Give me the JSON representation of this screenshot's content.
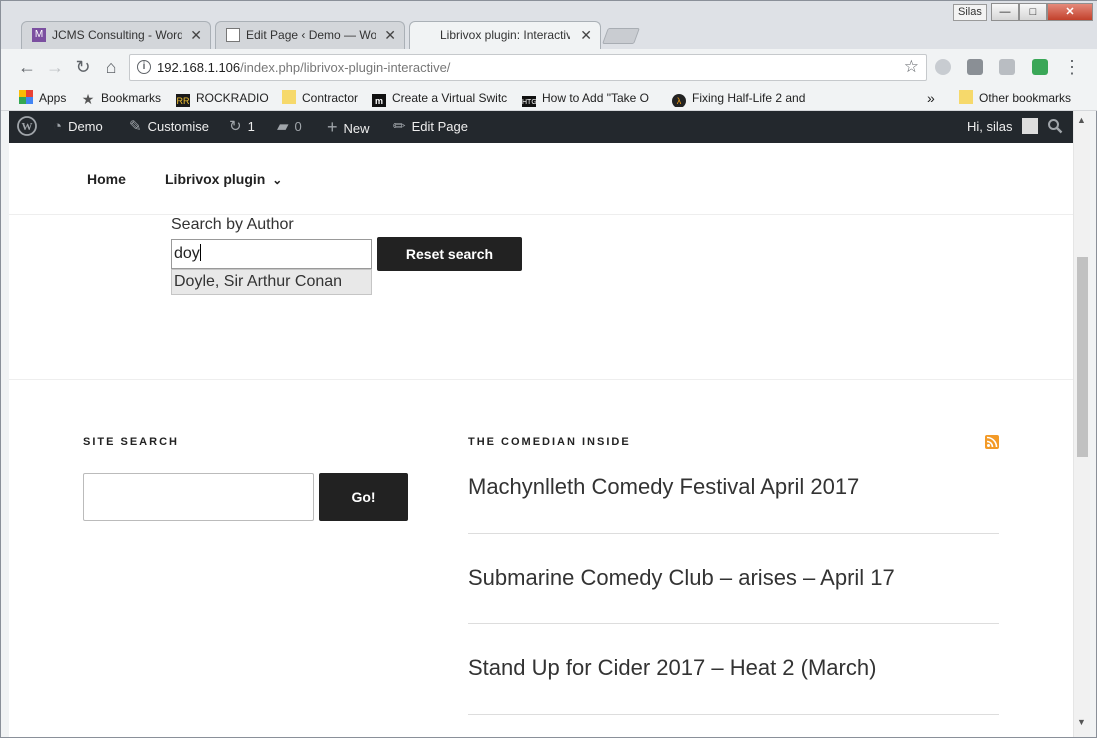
{
  "window": {
    "user_label": "Silas",
    "min_glyph": "—",
    "max_glyph": "□",
    "close_glyph": "✕"
  },
  "tabs": [
    {
      "title": "JCMS Consulting - Word",
      "close": "✕"
    },
    {
      "title": "Edit Page ‹ Demo — Wor",
      "close": "✕"
    },
    {
      "title": "Librivox plugin: Interactiv",
      "close": "✕"
    }
  ],
  "toolbar": {
    "back_glyph": "←",
    "forward_glyph": "→",
    "reload_glyph": "↻",
    "home_glyph": "⌂",
    "info_glyph": "i",
    "url_host": "192.168.1.106",
    "url_path": "/index.php/librivox-plugin-interactive/",
    "star_glyph": "☆",
    "menu_glyph": "⋮"
  },
  "bookmarks": {
    "items": [
      {
        "label": "Apps",
        "icon": "apps-grid-icon"
      },
      {
        "label": "Bookmarks",
        "icon": "star-icon"
      },
      {
        "label": "ROCKRADIO",
        "icon": "rockradio-icon",
        "badge": "RR"
      },
      {
        "label": "Contractor",
        "icon": "folder-icon"
      },
      {
        "label": "Create a Virtual Switc",
        "icon": "medium-icon",
        "badge": "m"
      },
      {
        "label": "How to Add \"Take O",
        "icon": "htg-icon",
        "badge": "HTG"
      },
      {
        "label": "Fixing Half-Life 2 and",
        "icon": "lambda-icon",
        "badge": "λ"
      }
    ],
    "overflow_glyph": "»",
    "other": "Other bookmarks"
  },
  "adminbar": {
    "site": "Demo",
    "customise": "Customise",
    "updates": "1",
    "comments": "0",
    "new": "New",
    "edit_page": "Edit Page",
    "greeting": "Hi, silas"
  },
  "nav": {
    "home": "Home",
    "librivox": "Librivox plugin",
    "chevron": "⌄"
  },
  "author_search": {
    "label": "Search by Author",
    "value": "doy",
    "reset_label": "Reset search",
    "suggestion": "Doyle, Sir Arthur Conan"
  },
  "site_search": {
    "title": "SITE SEARCH",
    "go_label": "Go!"
  },
  "comedian": {
    "title": "THE COMEDIAN INSIDE",
    "posts": [
      "Machynlleth Comedy Festival April 2017",
      "Submarine Comedy Club – arises – April 17",
      "Stand Up for Cider 2017 – Heat 2 (March)"
    ]
  }
}
